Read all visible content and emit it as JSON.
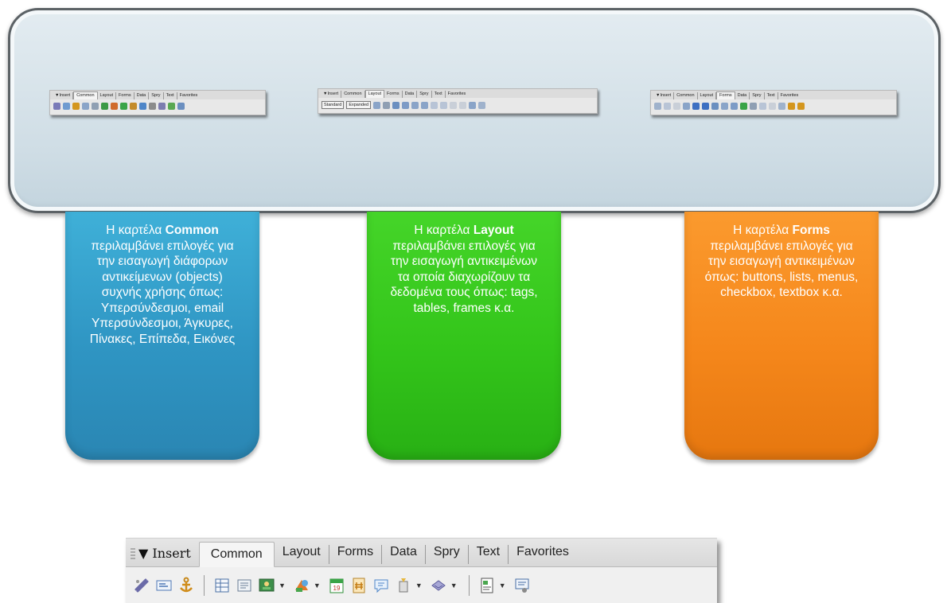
{
  "mini_toolbars": [
    {
      "insert": "▼Insert",
      "tabs": [
        "Common",
        "Layout",
        "Forms",
        "Data",
        "Spry",
        "Text",
        "Favorites"
      ],
      "active": "Common"
    },
    {
      "insert": "▼Insert",
      "tabs": [
        "Common",
        "Layout",
        "Forms",
        "Data",
        "Spry",
        "Text",
        "Favorites"
      ],
      "active": "Layout",
      "buttons": [
        "Standard",
        "Expanded"
      ]
    },
    {
      "insert": "▼Insert",
      "tabs": [
        "Common",
        "Layout",
        "Forms",
        "Data",
        "Spry",
        "Text",
        "Favorites"
      ],
      "active": "Forms"
    }
  ],
  "cards": {
    "common": {
      "prefix": "Η καρτέλα ",
      "name": "Common",
      "text": "περιλαμβάνει επιλογές για την εισαγωγή διάφορων αντικείμενων (objects) συχνής χρήσης όπως: Υπερσύνδεσμοι, email Υπερσύνδεσμοι, Άγκυρες, Πίνακες, Επίπεδα, Εικόνες",
      "color": "#3aa6d2"
    },
    "layout": {
      "prefix": "Η καρτέλα ",
      "name": "Layout",
      "text": "περιλαμβάνει επιλογές για την εισαγωγή αντικειμένων τα οποία διαχωρίζουν τα δεδομένα τους όπως: tags, tables, frames κ.α.",
      "color": "#3ccd22"
    },
    "forms": {
      "prefix": "Η καρτέλα ",
      "name": "Forms",
      "text": "περιλαμβάνει επιλογές για την εισαγωγή αντικειμένων όπως: buttons, lists, menus, checkbox, textbox κ.α.",
      "color": "#f48a20"
    }
  },
  "big_toolbar": {
    "insert_label": "▼ Insert",
    "tabs": [
      "Common",
      "Layout",
      "Forms",
      "Data",
      "Spry",
      "Text",
      "Favorites"
    ],
    "active_tab": "Common",
    "icons": [
      "hyperlink-icon",
      "email-link-icon",
      "named-anchor-icon",
      "table-icon",
      "insert-div-icon",
      "image-icon",
      "media-icon",
      "date-icon",
      "server-side-include-icon",
      "comment-icon",
      "head-icon",
      "script-icon",
      "templates-icon",
      "tag-chooser-icon"
    ]
  }
}
